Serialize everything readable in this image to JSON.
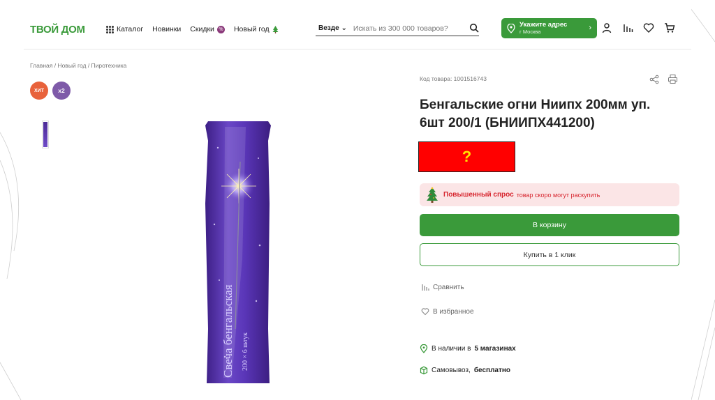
{
  "header": {
    "logo": "ТВОЙ ДОМ",
    "nav": {
      "catalog": "Каталог",
      "new": "Новинки",
      "sale": "Скидки",
      "sale_badge": "%",
      "new_year": "Новый год"
    },
    "search": {
      "scope": "Везде",
      "placeholder": "Искать из 300 000 товаров?"
    },
    "address": {
      "title": "Укажите адрес",
      "city": "г Москва"
    }
  },
  "breadcrumb": "Главная / Новый год / Пиротехника",
  "tags": {
    "hit": "ХИТ",
    "multiplier": "x2"
  },
  "product": {
    "code_label": "Код товара: 1001516743",
    "title": "Бенгальские огни Ниипх 200мм уп. 6шт 200/1 (БНИИПХ441200)",
    "price_placeholder": "?",
    "package_text": "Свеча бенгальская",
    "package_sub": "200 × 6 штук"
  },
  "demand": {
    "strong": "Повышенный спрос",
    "text": "товар скоро могут раскупить"
  },
  "buttons": {
    "cart": "В корзину",
    "one_click": "Купить в 1 клик"
  },
  "links": {
    "compare": "Сравнить",
    "favorite": "В избранное"
  },
  "availability": {
    "stock_prefix": "В наличии в",
    "stock_strong": "5 магазинах",
    "pickup_prefix": "Самовывоз,",
    "pickup_strong": "бесплатно"
  },
  "colors": {
    "brand_green": "#3a9a3a",
    "alert_red": "#d7262f",
    "tag_orange": "#e8623b",
    "tag_purple": "#7e5aa8"
  },
  "icons": [
    "grid-icon",
    "percent-badge",
    "tree-icon",
    "search-icon",
    "pin-icon",
    "chevron-right-icon",
    "user-icon",
    "compare-icon",
    "heart-icon",
    "cart-icon",
    "share-icon",
    "print-icon",
    "box-icon"
  ]
}
